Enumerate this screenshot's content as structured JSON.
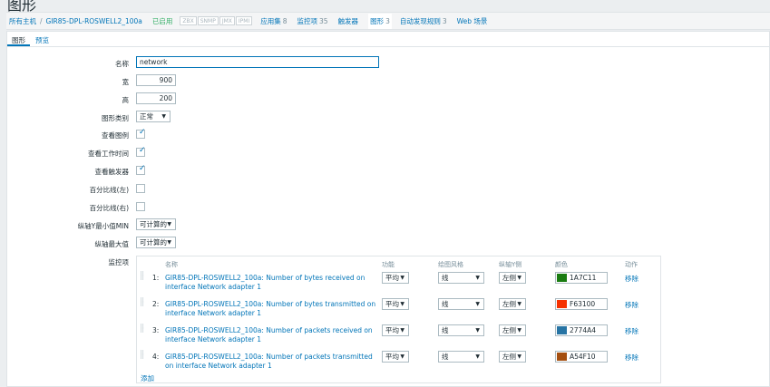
{
  "page_title": "图形",
  "nav": {
    "all_hosts": "所有主机",
    "separator": "/",
    "host": "GIR85-DPL-ROSWELL2_100a",
    "status": "已启用",
    "tags": [
      "ZBX",
      "SNMP",
      "JMX",
      "IPMI"
    ],
    "app_label": "应用集",
    "app_count": "8",
    "items_label": "监控项",
    "items_count": "35",
    "triggers_label": "触发器",
    "graphs_label": "图形",
    "graphs_count": "3",
    "discovery_label": "自动发现规则",
    "discovery_count": "3",
    "web_label": "Web 场景"
  },
  "tabs": {
    "graph": "图形",
    "preview": "预览"
  },
  "form": {
    "name_label": "名称",
    "name_value": "network",
    "width_label": "宽",
    "width_value": "900",
    "height_label": "高",
    "height_value": "200",
    "type_label": "图形类别",
    "type_value": "正常",
    "legend_label": "查看图例",
    "worktime_label": "查看工作时间",
    "triggers_label": "查看触发器",
    "percent_left_label": "百分比线(左)",
    "percent_right_label": "百分比线(右)",
    "ymin_label": "纵轴Y最小值MIN",
    "ymin_value": "可计算的",
    "ymax_label": "纵轴最大值",
    "ymax_value": "可计算的",
    "items_label": "监控项"
  },
  "items_table": {
    "headers": {
      "name": "名称",
      "function": "功能",
      "draw_style": "绘图风格",
      "y_side": "纵轴Y侧",
      "color": "颜色",
      "action": "动作"
    },
    "rows": [
      {
        "num": "1:",
        "name": "GIR85-DPL-ROSWELL2_100a: Number of bytes received on interface Network adapter 1",
        "function": "平均",
        "draw_style": "线",
        "y_side": "左侧",
        "color_hex": "#1A7C11",
        "color_code": "1A7C11",
        "action": "移除"
      },
      {
        "num": "2:",
        "name": "GIR85-DPL-ROSWELL2_100a: Number of bytes transmitted on interface Network adapter 1",
        "function": "平均",
        "draw_style": "线",
        "y_side": "左侧",
        "color_hex": "#F63100",
        "color_code": "F63100",
        "action": "移除"
      },
      {
        "num": "3:",
        "name": "GIR85-DPL-ROSWELL2_100a: Number of packets received on interface Network adapter 1",
        "function": "平均",
        "draw_style": "线",
        "y_side": "左侧",
        "color_hex": "#2774A4",
        "color_code": "2774A4",
        "action": "移除"
      },
      {
        "num": "4:",
        "name": "GIR85-DPL-ROSWELL2_100a: Number of packets transmitted on interface Network adapter 1",
        "function": "平均",
        "draw_style": "线",
        "y_side": "左侧",
        "color_hex": "#A54F10",
        "color_code": "A54F10",
        "action": "移除"
      }
    ],
    "add_label": "添加"
  },
  "icons": {
    "caret": "caret-down-icon",
    "checkmark": "check-icon",
    "drag": "drag-handle-icon"
  }
}
